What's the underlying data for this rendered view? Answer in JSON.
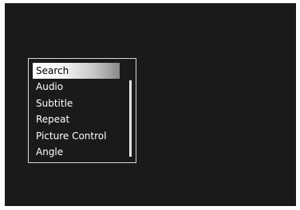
{
  "menu": {
    "items": [
      {
        "label": "Search",
        "selected": true
      },
      {
        "label": "Audio",
        "selected": false
      },
      {
        "label": "Subtitle",
        "selected": false
      },
      {
        "label": "Repeat",
        "selected": false
      },
      {
        "label": "Picture Control",
        "selected": false
      },
      {
        "label": "Angle",
        "selected": false
      }
    ]
  },
  "colors": {
    "screen_background": "#1b1a1a",
    "border": "#d8d8d8",
    "text": "#ffffff",
    "selected_text": "#000000"
  }
}
